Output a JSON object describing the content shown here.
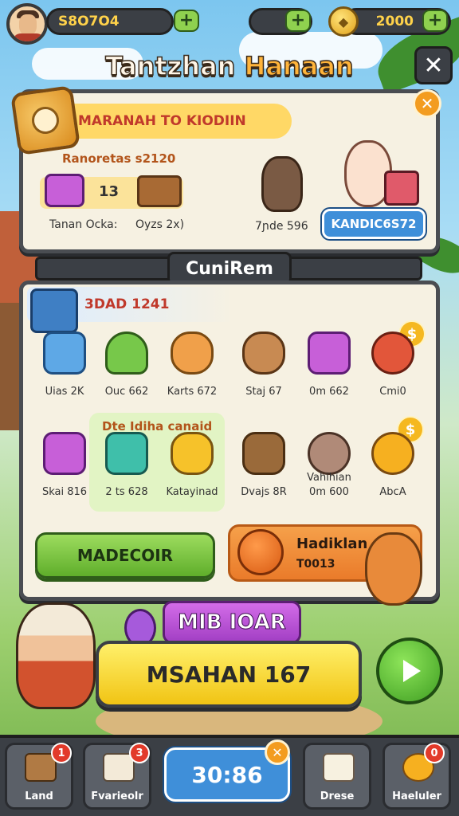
{
  "hud": {
    "score": "S8O7O4",
    "coins": "2000",
    "plus": "+"
  },
  "title": {
    "part1": "Tantzhan ",
    "part2": "Hanaan"
  },
  "close_glyph": "✕",
  "top_panel": {
    "ribbon": "MARANAH TO KIODIIN",
    "subtitle": "Ranoretas s2120",
    "reward_count": "13",
    "footer_left": "Tanan Ocka:",
    "footer_mid": "Oyzs 2x)",
    "footer_right": "7ɲde 596",
    "button": "KANDIC6S72",
    "close": "✕"
  },
  "section_tab": "CuniRem",
  "shop": {
    "header": "3DAD 1241",
    "highlight_label": "Dte Idiha canaid",
    "row1": [
      {
        "label": "Uias 2K",
        "icon": "machine-icon"
      },
      {
        "label": "Ouc 662",
        "icon": "plant-icon"
      },
      {
        "label": "Karts 672",
        "icon": "cat-icon"
      },
      {
        "label": "Staj 67",
        "icon": "bear-icon"
      },
      {
        "label": "0m 662",
        "icon": "shop-icon"
      },
      {
        "label": "Cmi0",
        "icon": "bird-icon"
      }
    ],
    "row2": [
      {
        "label": "Skai 816",
        "icon": "chest-icon"
      },
      {
        "label": "2 ts 628",
        "icon": "gift-icon"
      },
      {
        "label": "Katayinad",
        "icon": "cheese-icon"
      },
      {
        "label": "Dvajs 8R",
        "icon": "log-icon"
      },
      {
        "label": "0m 600",
        "icon": "mouse-icon",
        "extra": "Vahihian"
      },
      {
        "label": "AbcA",
        "icon": "fruit-icon"
      }
    ],
    "dollar": "$"
  },
  "actions": {
    "green_button": "MADECOIR",
    "card_title": "Hadiklan",
    "card_value": "T0013"
  },
  "cta": {
    "purple": "MIB IOAR",
    "yellow": "MSAHAN 167"
  },
  "nav": [
    {
      "label": "Land",
      "badge": "1",
      "icon": "crate-icon"
    },
    {
      "label": "Fvarieolr",
      "badge": "3",
      "icon": "book-icon"
    },
    {
      "label": "30:86",
      "badge": "✕",
      "icon": "timer"
    },
    {
      "label": "Drese",
      "badge": "",
      "icon": "paper-icon"
    },
    {
      "label": "Haeluler",
      "badge": "0",
      "icon": "fruit-icon"
    }
  ],
  "colors": {
    "panel_border": "#4a4d52",
    "panel_bg": "#f6f1e2",
    "accent_orange": "#f39c1f",
    "accent_green": "#5fae2b",
    "accent_blue": "#3f8fd9"
  }
}
